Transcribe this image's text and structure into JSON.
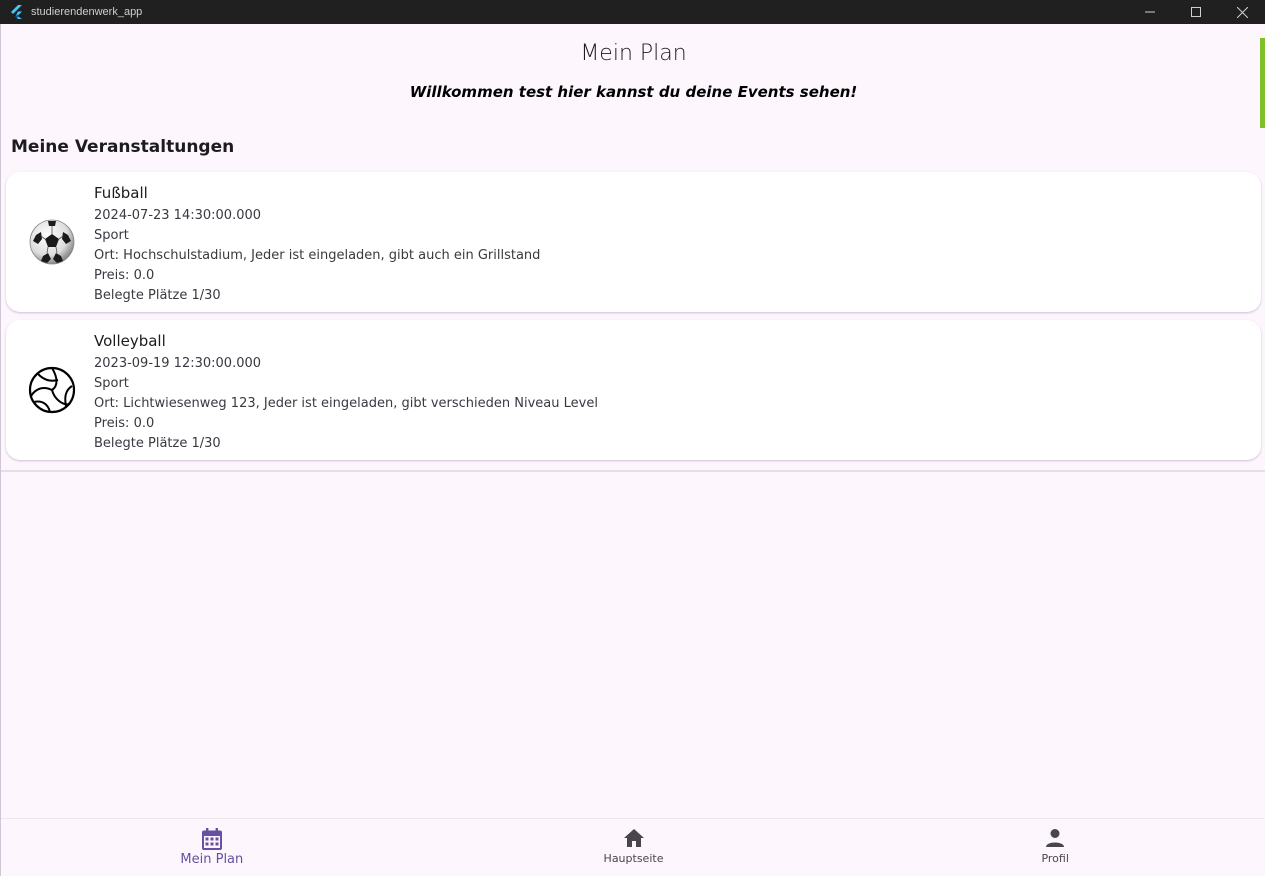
{
  "window": {
    "title": "studierendenwerk_app",
    "controls": [
      "minimize",
      "maximize",
      "close"
    ]
  },
  "page": {
    "title": "Mein Plan",
    "welcome": "Willkommen test hier kannst du deine Events sehen!",
    "section_title": "Meine Veranstaltungen"
  },
  "events": [
    {
      "name": "Fußball",
      "datetime": "2024-07-23 14:30:00.000",
      "category": "Sport",
      "location": "Ort: Hochschulstadium, Jeder ist eingeladen, gibt auch ein Grillstand",
      "price": "Preis: 0.0",
      "seats": "Belegte Plätze 1/30",
      "icon": "soccer-ball-icon"
    },
    {
      "name": "Volleyball",
      "datetime": "2023-09-19 12:30:00.000",
      "category": "Sport",
      "location": "Ort: Lichtwiesenweg 123, Jeder ist eingeladen, gibt verschieden Niveau Level",
      "price": "Preis: 0.0",
      "seats": "Belegte Plätze 1/30",
      "icon": "volleyball-icon"
    }
  ],
  "nav": {
    "items": [
      {
        "label": "Mein Plan",
        "icon": "calendar-icon",
        "active": true
      },
      {
        "label": "Hauptseite",
        "icon": "home-icon",
        "active": false
      },
      {
        "label": "Profil",
        "icon": "person-icon",
        "active": false
      }
    ]
  },
  "colors": {
    "accent": "#6750a4",
    "background": "#fdf7fd",
    "titlebar": "#202020",
    "scroll_indicator": "#7cc226"
  }
}
